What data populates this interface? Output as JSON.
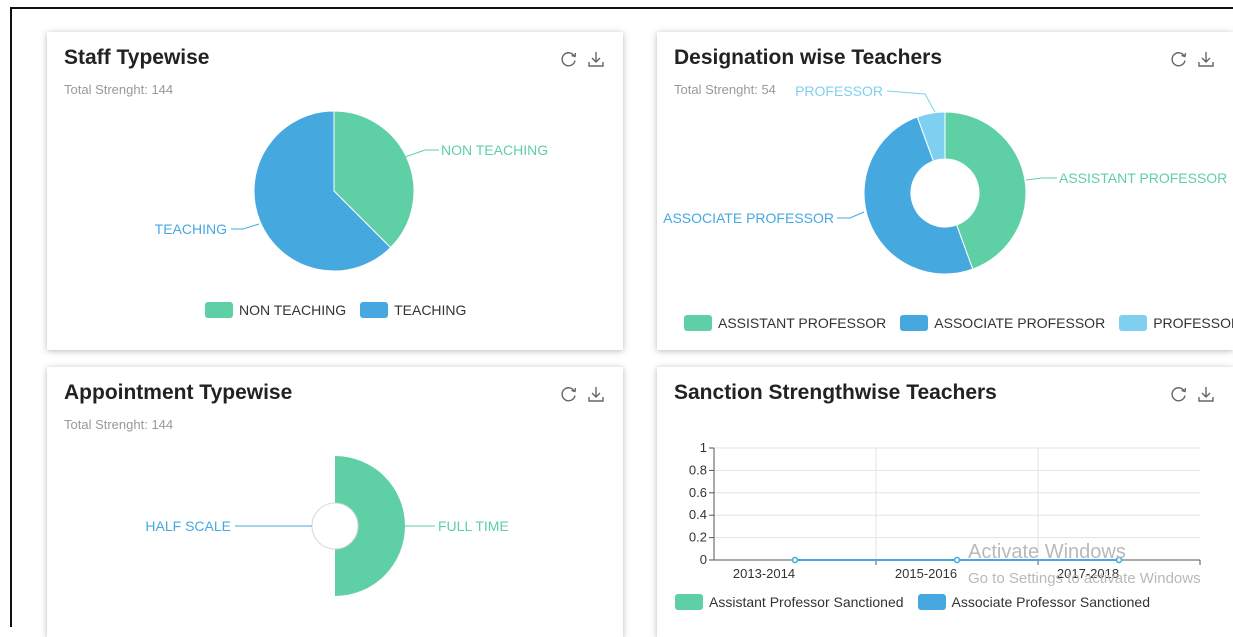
{
  "cards": [
    {
      "title": "Staff Typewise",
      "subtitle": "Total Strenght: 144",
      "chart_data": {
        "type": "pie",
        "slices": [
          {
            "name": "NON TEACHING",
            "value": 54,
            "color": "#5fcfa6"
          },
          {
            "name": "TEACHING",
            "value": 90,
            "color": "#45a9e0"
          }
        ],
        "legend": [
          "NON TEACHING",
          "TEACHING"
        ],
        "legend_position": "bottom"
      }
    },
    {
      "title": "Designation wise Teachers",
      "subtitle": "Total Strenght: 54",
      "chart_data": {
        "type": "pie",
        "donut": true,
        "slices": [
          {
            "name": "ASSISTANT PROFESSOR",
            "value": 24,
            "color": "#5fcfa6"
          },
          {
            "name": "ASSOCIATE PROFESSOR",
            "value": 27,
            "color": "#45a9e0"
          },
          {
            "name": "PROFESSOR",
            "value": 3,
            "color": "#7fd0f0"
          }
        ],
        "legend": [
          "ASSISTANT PROFESSOR",
          "ASSOCIATE PROFESSOR",
          "PROFESSOR"
        ],
        "legend_position": "bottom"
      }
    },
    {
      "title": "Appointment Typewise",
      "subtitle": "Total Strenght: 144",
      "chart_data": {
        "type": "pie",
        "donut": true,
        "slices": [
          {
            "name": "FULL TIME",
            "value": 144,
            "color": "#5fcfa6"
          },
          {
            "name": "HALF SCALE",
            "value": 0,
            "color": "#45a9e0"
          }
        ]
      }
    },
    {
      "title": "Sanction Strengthwise Teachers",
      "subtitle": "",
      "chart_data": {
        "type": "line",
        "categories": [
          "2013-2014",
          "2015-2016",
          "2017-2018"
        ],
        "yticks": [
          "0",
          "0.2",
          "0.4",
          "0.6",
          "0.8",
          "1"
        ],
        "ylim": [
          0,
          1
        ],
        "grid": true,
        "series": [
          {
            "name": "Assistant Professor Sanctioned",
            "values": [
              0,
              0,
              0
            ],
            "color": "#5fcfa6"
          },
          {
            "name": "Associate Professor Sanctioned",
            "values": [
              0,
              0,
              0
            ],
            "color": "#45a9e0"
          }
        ],
        "legend": [
          "Assistant Professor Sanctioned",
          "Associate Professor Sanctioned"
        ],
        "legend_position": "bottom"
      }
    }
  ],
  "watermark": {
    "line1": "Activate Windows",
    "line2": "Go to Settings to activate Windows"
  },
  "icons": {
    "refresh": "refresh-icon",
    "download": "download-icon"
  }
}
